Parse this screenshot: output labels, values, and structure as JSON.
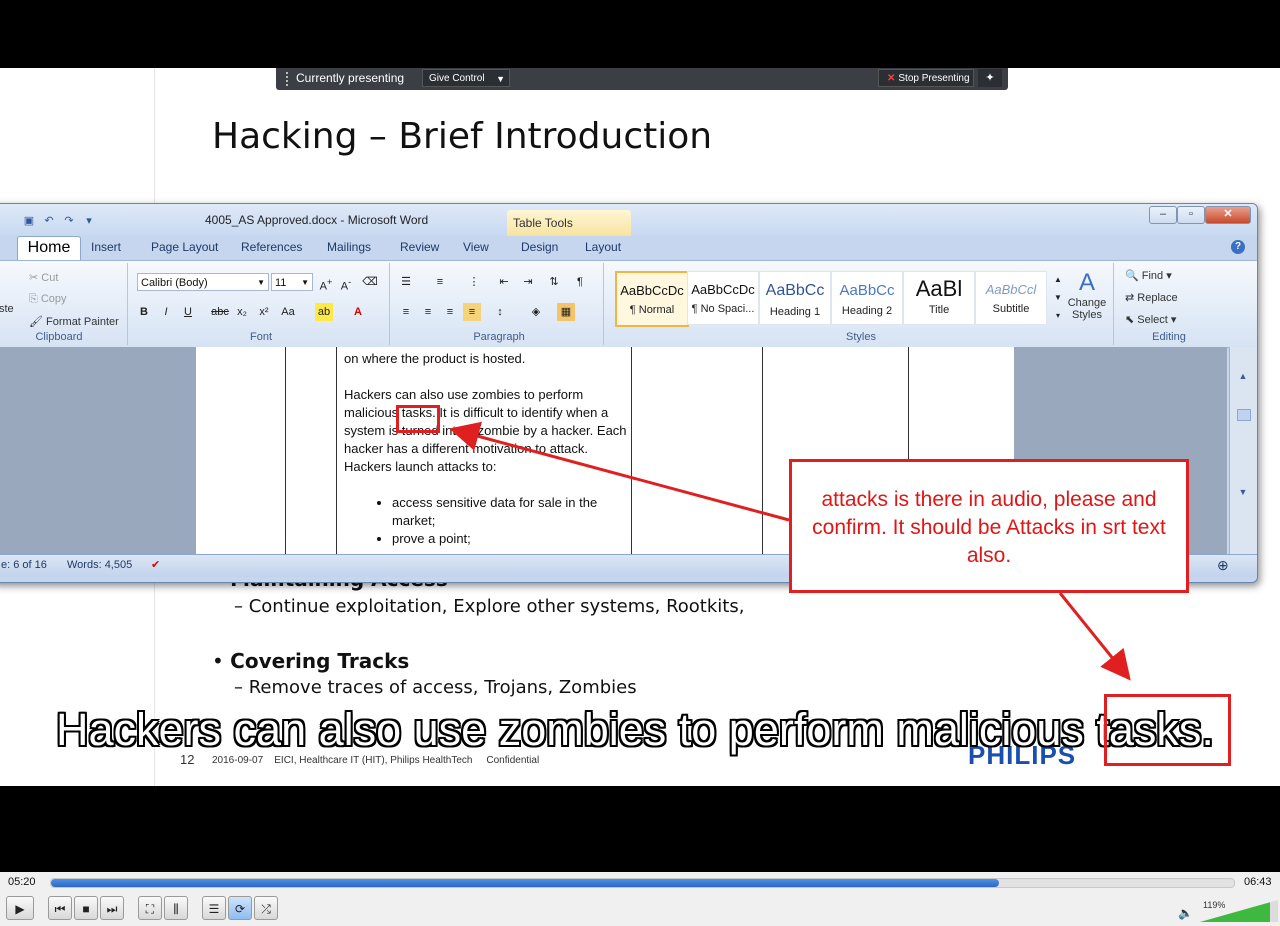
{
  "presenter_bar": {
    "status": "Currently presenting",
    "give_control": "Give Control",
    "stop": "Stop Presenting"
  },
  "slide": {
    "title": "Hacking – Brief Introduction",
    "bullets": [
      {
        "heading": "Maintaining Access",
        "sub": "–  Continue exploitation, Explore other systems, Rootkits,"
      },
      {
        "heading": "Covering Tracks",
        "sub": "–  Remove traces of access, Trojans, Zombies"
      }
    ],
    "page_number": "12",
    "footer": "2016-09-07    EICI, Healthcare IT (HIT), Philips HealthTech     Confidential",
    "logo": "PHILIPS"
  },
  "subtitle": "Hackers can also use zombies to perform malicious tasks.",
  "word": {
    "title": "4005_AS Approved.docx - Microsoft Word",
    "table_tools": "Table Tools",
    "tabs": [
      "Home",
      "Insert",
      "Page Layout",
      "References",
      "Mailings",
      "Review",
      "View",
      "Design",
      "Layout"
    ],
    "clipboard": {
      "label": "Clipboard",
      "paste": "ste",
      "cut": "Cut",
      "copy": "Copy",
      "format_painter": "Format Painter"
    },
    "font": {
      "label": "Font",
      "family": "Calibri (Body)",
      "size": "11"
    },
    "paragraph": {
      "label": "Paragraph"
    },
    "styles": {
      "label": "Styles",
      "items": [
        {
          "sample": "AaBbCcDc",
          "name": "¶ Normal"
        },
        {
          "sample": "AaBbCcDc",
          "name": "¶ No Spaci..."
        },
        {
          "sample": "AaBbCc",
          "name": "Heading 1"
        },
        {
          "sample": "AaBbCc",
          "name": "Heading 2"
        },
        {
          "sample": "AaBl",
          "name": "Title"
        },
        {
          "sample": "AaBbCcl",
          "name": "Subtitle"
        }
      ],
      "change": "Change Styles"
    },
    "editing": {
      "label": "Editing",
      "find": "Find",
      "replace": "Replace",
      "select": "Select"
    },
    "doc": {
      "line1": "on where the product is hosted.",
      "para": "Hackers can also use zombies to perform malicious tasks. It is difficult to identify when a system is turned into a zombie by a hacker. Each hacker has a different motivation to attack. Hackers launch attacks to:",
      "list": [
        "access sensitive data for sale in the market;",
        "prove a point;"
      ]
    },
    "status": {
      "page": "e: 6 of 16",
      "words": "Words: 4,505"
    }
  },
  "annotation": {
    "text": "attacks is there in audio, please and confirm. It should be Attacks in srt text also.",
    "color": "#e02020"
  },
  "player": {
    "current_time": "05:20",
    "total_time": "06:43",
    "progress": 0.801,
    "volume": "119%"
  }
}
